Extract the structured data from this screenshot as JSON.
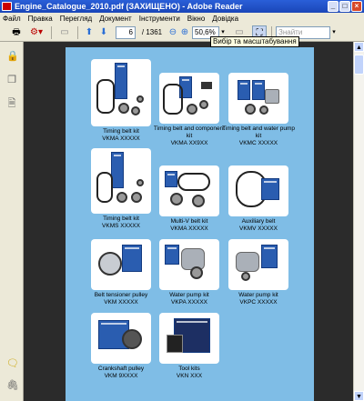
{
  "window": {
    "title": "Engine_Catalogue_2010.pdf (ЗАХИЩЕНО) - Adobe Reader",
    "buttons": [
      "_",
      "□",
      "×"
    ]
  },
  "menu": [
    "Файл",
    "Правка",
    "Перегляд",
    "Документ",
    "Інструменти",
    "Вікно",
    "Довідка"
  ],
  "toolbar": {
    "page_current": "6",
    "page_total": "/ 1361",
    "zoom": "50,6%",
    "search_placeholder": "Знайти",
    "tooltip": "Вибір та масштабування"
  },
  "catalog": [
    {
      "name": "Timing belt kit",
      "code": "VKMA XXXXX"
    },
    {
      "name": "Timing belt and component kit",
      "code": "VKMA XX9XX"
    },
    {
      "name": "Timing belt and water pump kit",
      "code": "VKMC XXXXX"
    },
    {
      "name": "Timing belt kit",
      "code": "VKMS XXXXX"
    },
    {
      "name": "Multi-V belt kit",
      "code": "VKMA XXXXX"
    },
    {
      "name": "Auxiliary belt",
      "code": "VKMV XXXXX"
    },
    {
      "name": "Belt tensioner pulley",
      "code": "VKM XXXXX"
    },
    {
      "name": "Water pump kit",
      "code": "VKPA XXXXX"
    },
    {
      "name": "Water pump kit",
      "code": "VKPC XXXXX"
    },
    {
      "name": "Crankshaft pulley",
      "code": "VKM 9XXXX"
    },
    {
      "name": "Tool kits",
      "code": "VKN XXX"
    }
  ]
}
